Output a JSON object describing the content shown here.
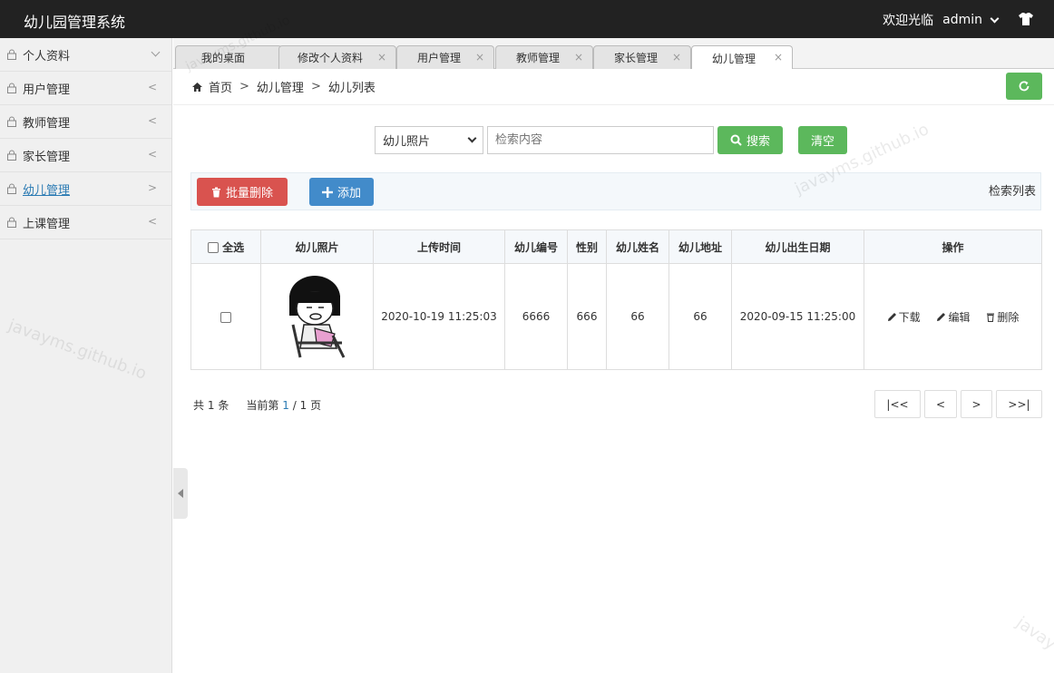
{
  "header": {
    "app_title": "幼儿园管理系统",
    "welcome": "欢迎光临",
    "username": "admin"
  },
  "sidebar": {
    "items": [
      {
        "label": "个人资料",
        "arrow": "down"
      },
      {
        "label": "用户管理",
        "arrow": "<"
      },
      {
        "label": "教师管理",
        "arrow": "<"
      },
      {
        "label": "家长管理",
        "arrow": "<"
      },
      {
        "label": "幼儿管理",
        "arrow": ">"
      },
      {
        "label": "上课管理",
        "arrow": "<"
      }
    ]
  },
  "tabs": [
    {
      "label": "我的桌面"
    },
    {
      "label": "修改个人资料",
      "close": "×"
    },
    {
      "label": "用户管理",
      "close": "×"
    },
    {
      "label": "教师管理",
      "close": "×"
    },
    {
      "label": "家长管理",
      "close": "×"
    },
    {
      "label": "幼儿管理",
      "close": "×"
    }
  ],
  "breadcrumb": {
    "home": "首页",
    "sep": ">",
    "level1": "幼儿管理",
    "level2": "幼儿列表"
  },
  "search": {
    "field_selected": "幼儿照片",
    "placeholder": "检索内容",
    "search_label": "搜索",
    "clear_label": "清空"
  },
  "toolbar": {
    "batch_delete_label": "批量删除",
    "add_label": "添加",
    "list_label": "检索列表"
  },
  "table": {
    "select_all_label": "全选",
    "columns": [
      "幼儿照片",
      "上传时间",
      "幼儿编号",
      "性别",
      "幼儿姓名",
      "幼儿地址",
      "幼儿出生日期",
      "操作"
    ],
    "rows": [
      {
        "upload_time": "2020-10-19 11:25:03",
        "child_no": "6666",
        "gender": "666",
        "name": "66",
        "address": "66",
        "birth_date": "2020-09-15 11:25:00",
        "op_download": "下载",
        "op_edit": "编辑",
        "op_delete": "删除"
      }
    ]
  },
  "pagination": {
    "total_prefix": "共",
    "total_count": "1",
    "total_suffix": "条",
    "current_prefix": "当前第",
    "current_page": "1",
    "page_sep": "/",
    "total_pages": "1",
    "page_suffix": "页",
    "first": "|<<",
    "prev": "<",
    "next": ">",
    "last": ">>|"
  },
  "watermarks": [
    "javayms.github.io",
    "javayms.github.io",
    "javayms.github.io",
    "javay"
  ],
  "colors": {
    "header_bg": "#222222",
    "success": "#5cb85c",
    "danger": "#d9534f",
    "primary": "#428bca",
    "link": "#2a7ab3"
  }
}
